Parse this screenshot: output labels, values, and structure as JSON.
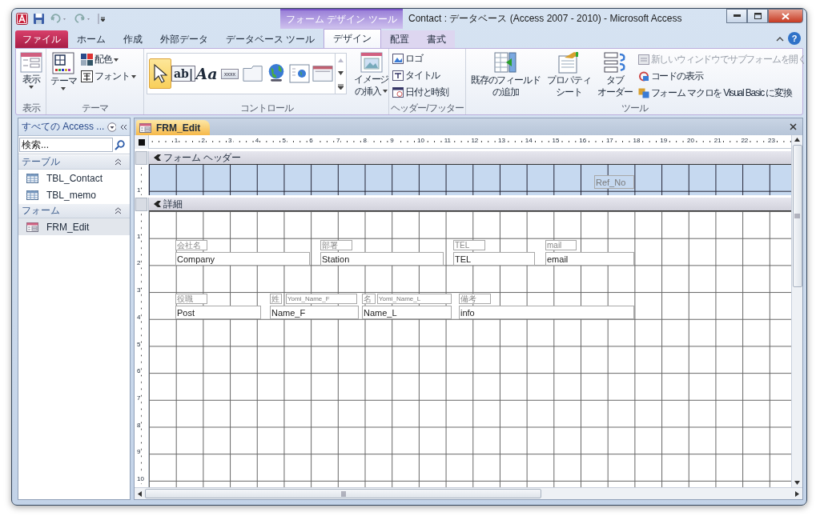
{
  "title_bar": {
    "context_group": "フォーム デザイン ツール",
    "title": "Contact : データベース (Access 2007 - 2010) - Microsoft Access",
    "help_glyph": "?"
  },
  "ribbon_tabs": [
    {
      "label": "ファイル",
      "kind": "file",
      "selected": false
    },
    {
      "label": "ホーム",
      "kind": "tab",
      "selected": false
    },
    {
      "label": "作成",
      "kind": "tab",
      "selected": false
    },
    {
      "label": "外部データ",
      "kind": "tab",
      "selected": false
    },
    {
      "label": "データベース ツール",
      "kind": "tab",
      "selected": false
    },
    {
      "label": "デザイン",
      "kind": "context",
      "selected": true
    },
    {
      "label": "配置",
      "kind": "context",
      "selected": false
    },
    {
      "label": "書式",
      "kind": "context",
      "selected": false
    }
  ],
  "ribbon": {
    "view": {
      "label": "表示",
      "group": "表示"
    },
    "theme": {
      "themes": "テーマ",
      "colors": "配色",
      "fonts": "フォント",
      "group": "テーマ"
    },
    "controls": {
      "gallery": [
        {
          "kind": "pointer",
          "selected": true
        },
        {
          "kind": "textbox",
          "glyph": "ab|",
          "selected": false
        },
        {
          "kind": "label",
          "glyph": "Aa",
          "selected": false
        },
        {
          "kind": "button",
          "glyph": "xxxx",
          "selected": false
        },
        {
          "kind": "tab",
          "selected": false
        },
        {
          "kind": "hyperlink",
          "selected": false
        },
        {
          "kind": "browser",
          "selected": false
        },
        {
          "kind": "navigation",
          "selected": false
        }
      ],
      "insert_image": [
        "イメージ",
        "の挿入"
      ],
      "group": "コントロール"
    },
    "header_footer": {
      "items": [
        {
          "label": "ロゴ",
          "kind": "logo"
        },
        {
          "label": "タイトル",
          "kind": "title"
        },
        {
          "label": "日付と時刻",
          "kind": "datetime"
        }
      ],
      "group": "ヘッダー/フッター"
    },
    "tools": {
      "large": [
        {
          "lines": [
            "既存のフィールド",
            "の追加"
          ],
          "kind": "fields"
        },
        {
          "lines": [
            "プロパティ",
            "シート"
          ],
          "kind": "properties"
        },
        {
          "lines": [
            "タブ",
            "オーダー"
          ],
          "kind": "taborder"
        }
      ],
      "small": [
        {
          "label": "新しいウィンドウでサブフォームを開く",
          "kind": "subform",
          "disabled": true
        },
        {
          "label": "コードの表示",
          "kind": "code",
          "disabled": false
        },
        {
          "label": "フォーム マクロを Visual Basic に変換",
          "kind": "convert",
          "disabled": false
        }
      ],
      "group": "ツール"
    }
  },
  "nav_pane": {
    "title": "すべての Access ...",
    "search": {
      "placeholder": "検索..."
    },
    "groups": [
      {
        "label": "テーブル",
        "expanded": true,
        "items": [
          {
            "label": "TBL_Contact",
            "kind": "table",
            "selected": false
          },
          {
            "label": "TBL_memo",
            "kind": "table",
            "selected": false
          }
        ]
      },
      {
        "label": "フォーム",
        "expanded": true,
        "items": [
          {
            "label": "FRM_Edit",
            "kind": "form",
            "selected": true
          }
        ]
      }
    ]
  },
  "document": {
    "tab": "FRM_Edit",
    "ruler": [
      "1",
      "2",
      "3",
      "4",
      "5",
      "6",
      "7",
      "8",
      "9",
      "10",
      "11",
      "12",
      "13",
      "14",
      "15",
      "16",
      "17",
      "18",
      "19",
      "20",
      "21",
      "22",
      "23"
    ],
    "sections": [
      {
        "label": "フォーム ヘッダー",
        "kind": "header",
        "ruler": [
          "1"
        ],
        "controls": [
          {
            "kind": "dim_textbox",
            "text": "Ref_No"
          }
        ]
      },
      {
        "label": "詳細",
        "kind": "detail",
        "ruler": [
          "1",
          "2",
          "3",
          "4",
          "5",
          "6",
          "7",
          "8",
          "9",
          "10"
        ],
        "controls": [
          {
            "kind": "label",
            "text": "会社名"
          },
          {
            "kind": "label",
            "text": "部署"
          },
          {
            "kind": "label",
            "text": "TEL"
          },
          {
            "kind": "label",
            "text": "mail"
          },
          {
            "kind": "textbox",
            "text": "Company"
          },
          {
            "kind": "textbox",
            "text": "Station"
          },
          {
            "kind": "textbox",
            "text": "TEL"
          },
          {
            "kind": "textbox",
            "text": "email"
          },
          {
            "kind": "label",
            "text": "役職"
          },
          {
            "kind": "label",
            "text": "姓"
          },
          {
            "kind": "mini_textbox",
            "text": "Yomi_Name_F"
          },
          {
            "kind": "label",
            "text": "名"
          },
          {
            "kind": "mini_textbox",
            "text": "Yomi_Name_L"
          },
          {
            "kind": "label",
            "text": "備考"
          },
          {
            "kind": "textbox",
            "text": "Post"
          },
          {
            "kind": "textbox",
            "text": "Name_F"
          },
          {
            "kind": "textbox",
            "text": "Name_L"
          },
          {
            "kind": "textbox",
            "text": "info"
          }
        ]
      }
    ]
  }
}
